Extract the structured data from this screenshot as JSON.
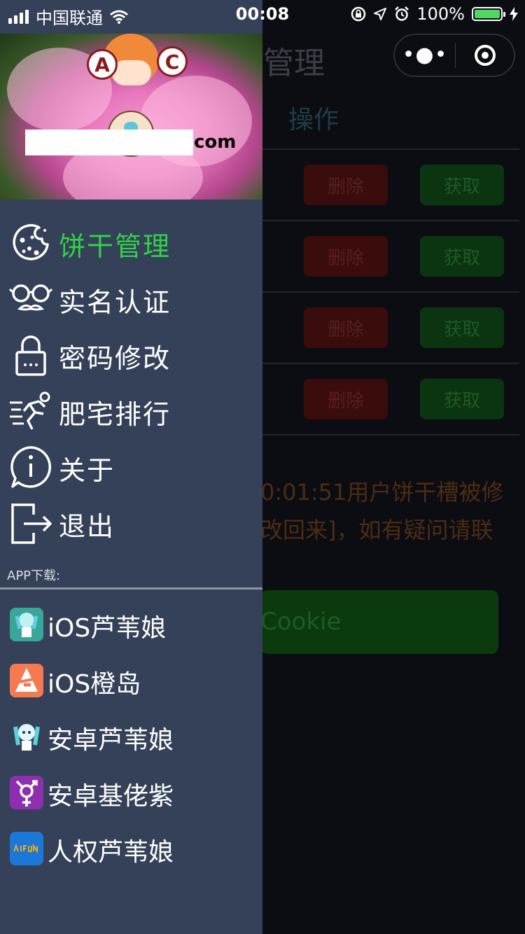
{
  "status_bar": {
    "carrier": "中国联通",
    "time": "00:08",
    "battery_text": "100%",
    "battery_level": 1.0,
    "battery_color": "#4cd964"
  },
  "background_page": {
    "title": "管理",
    "column_header": "操作",
    "rows": [
      {
        "delete_label": "删除",
        "get_label": "获取"
      },
      {
        "delete_label": "删除",
        "get_label": "获取"
      },
      {
        "delete_label": "删除",
        "get_label": "获取"
      },
      {
        "delete_label": "删除",
        "get_label": "获取"
      }
    ],
    "notice_line1": "0:01:51用户饼干槽被修",
    "notice_line2": "改回来]，如有疑问请联",
    "cookie_button": "Cookie",
    "capsule": {
      "more_icon": "more-dots-icon",
      "close_icon": "target-icon"
    }
  },
  "drawer": {
    "banner": {
      "suffix_text": "com",
      "mascot_letters": [
        "A",
        "C"
      ]
    },
    "menu": [
      {
        "label": "饼干管理",
        "icon": "cookie-icon",
        "active": true
      },
      {
        "label": "实名认证",
        "icon": "glasses-mustache-icon",
        "active": false
      },
      {
        "label": "密码修改",
        "icon": "lock-icon",
        "active": false
      },
      {
        "label": "肥宅排行",
        "icon": "running-man-icon",
        "active": false
      },
      {
        "label": "关于",
        "icon": "info-bubble-icon",
        "active": false
      },
      {
        "label": "退出",
        "icon": "logout-icon",
        "active": false
      }
    ],
    "active_color": "#33d04a",
    "app_download_title": "APP下载:",
    "apps": [
      {
        "label": "iOS芦苇娘",
        "icon": "reed-girl-teal-icon"
      },
      {
        "label": "iOS橙岛",
        "icon": "orange-island-icon"
      },
      {
        "label": "安卓芦苇娘",
        "icon": "reed-girl-icon"
      },
      {
        "label": "安卓基佬紫",
        "icon": "gender-symbol-purple-icon"
      },
      {
        "label": "人权芦苇娘",
        "icon": "acfun-blue-icon"
      }
    ]
  }
}
